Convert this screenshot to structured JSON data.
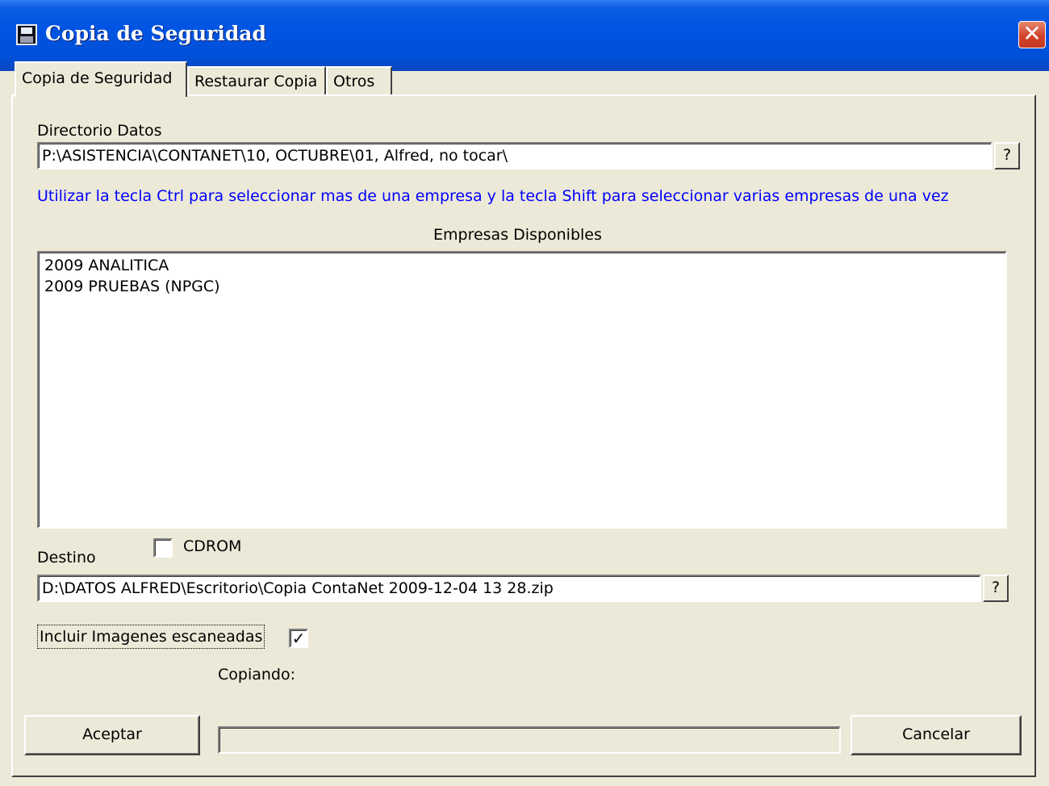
{
  "window": {
    "title": "Copia de Seguridad",
    "close_label": "✕"
  },
  "tabs": [
    {
      "label": "Copia de Seguridad",
      "active": true
    },
    {
      "label": "Restaurar Copia",
      "active": false
    },
    {
      "label": "Otros",
      "active": false
    }
  ],
  "data_dir": {
    "label": "Directorio Datos",
    "value": "P:\\ASISTENCIA\\CONTANET\\10, OCTUBRE\\01, Alfred, no tocar\\",
    "browse_label": "?"
  },
  "hint_text": "Utilizar la tecla Ctrl para seleccionar mas de una empresa y la tecla Shift para seleccionar varias empresas de una vez",
  "companies": {
    "title": "Empresas Disponibles",
    "items": [
      "2009 ANALITICA",
      "2009 PRUEBAS (NPGC)"
    ]
  },
  "destination": {
    "label": "Destino",
    "cdrom_label": "CDROM",
    "cdrom_checked": false,
    "value": "D:\\DATOS ALFRED\\Escritorio\\Copia ContaNet 2009-12-04 13 28.zip",
    "browse_label": "?"
  },
  "include_images": {
    "label": "Incluir Imagenes escaneadas",
    "checked": true,
    "check_mark": "✓"
  },
  "status": {
    "copying_label": "Copiando:",
    "progress": 0
  },
  "buttons": {
    "accept": "Aceptar",
    "cancel": "Cancelar"
  },
  "colors": {
    "titlebar": "#0054e3",
    "hint": "#0000ff",
    "dialog_bg": "#ece9d8"
  }
}
